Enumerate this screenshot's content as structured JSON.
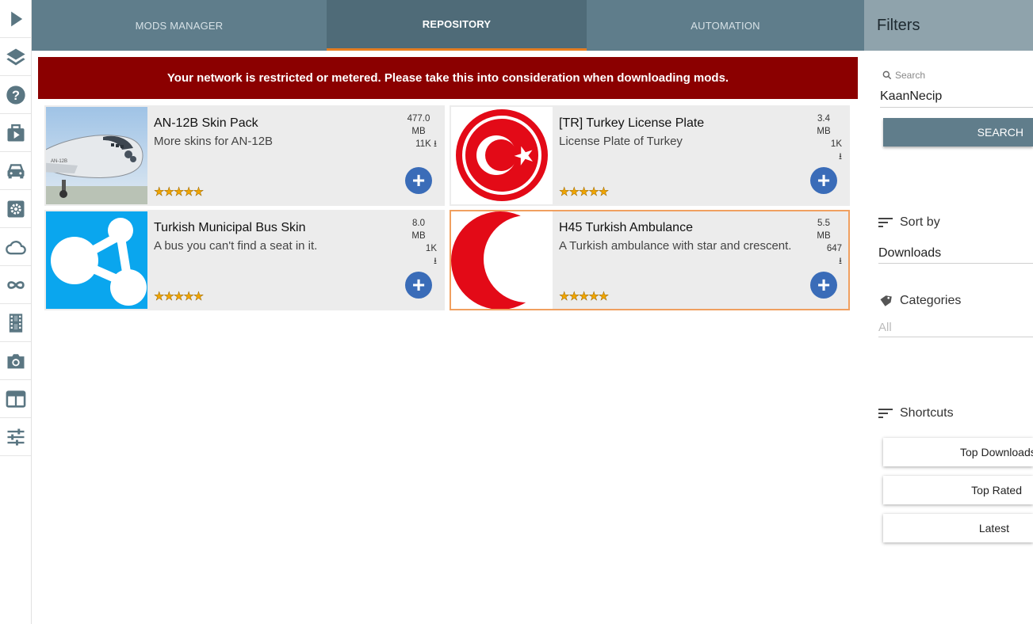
{
  "tabs": [
    {
      "label": "MODS MANAGER"
    },
    {
      "label": "REPOSITORY"
    },
    {
      "label": "AUTOMATION"
    }
  ],
  "banner": "Your network is restricted or metered. Please take this into consideration when downloading mods.",
  "mods": [
    {
      "title": "AN-12B Skin Pack",
      "description": "More skins for AN-12B",
      "size": "477.0",
      "size_unit": "MB",
      "downloads": "11K",
      "rating": 5,
      "stars": "★★★★★"
    },
    {
      "title": "[TR] Turkey License Plate",
      "description": "License Plate of Turkey",
      "size": "3.4",
      "size_unit": "MB",
      "downloads": "1K",
      "rating": 5,
      "stars": "★★★★★"
    },
    {
      "title": "Turkish Municipal Bus Skin",
      "description": "A bus you can't find a seat in it.",
      "size": "8.0",
      "size_unit": "MB",
      "downloads": "1K",
      "rating": 5,
      "stars": "★★★★★"
    },
    {
      "title": "H45 Turkish Ambulance",
      "description": "A Turkish ambulance with star and crescent.",
      "size": "5.5",
      "size_unit": "MB",
      "downloads": "647",
      "rating": 5,
      "stars": "★★★★★"
    }
  ],
  "filters": {
    "title": "Filters",
    "search_label": "Search",
    "search_value": "KaanNecip",
    "search_button": "SEARCH",
    "sort_label": "Sort by",
    "sort_value": "Downloads",
    "categories_label": "Categories",
    "categories_placeholder": "All",
    "shortcuts_label": "Shortcuts",
    "shortcuts": [
      "Top Downloads",
      "Top Rated",
      "Latest"
    ]
  },
  "colors": {
    "tab_bar": "#5f7d8b",
    "tab_active": "#4f6b78",
    "tab_indicator": "#e67e22",
    "banner": "#8b0000",
    "add_button": "#3a6cb8",
    "selected_border": "#f0a060"
  },
  "icons": [
    "play-icon",
    "layers-icon",
    "help-icon",
    "suitcase-icon",
    "car-icon",
    "settings-icon",
    "cloud-icon",
    "infinity-icon",
    "film-icon",
    "camera-icon",
    "dashboard-icon",
    "sliders-icon"
  ]
}
